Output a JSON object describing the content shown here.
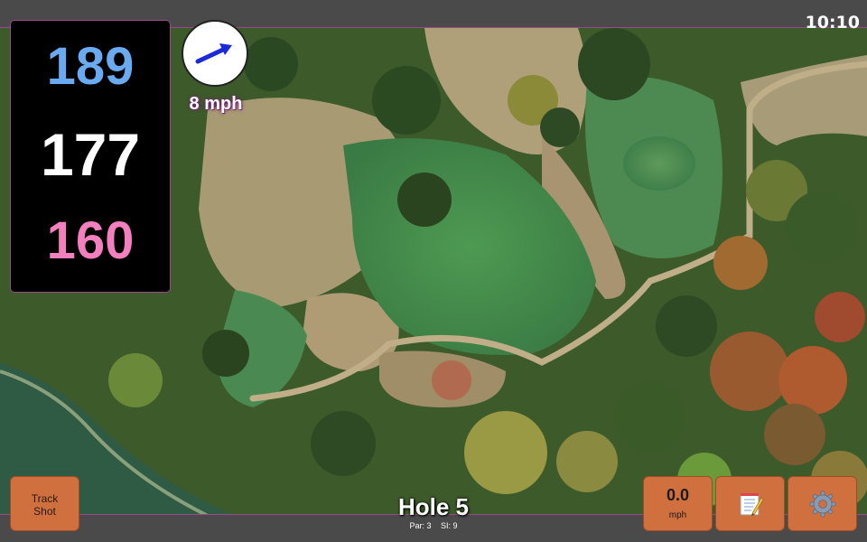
{
  "status_bar": {
    "time": "10:10"
  },
  "distances": {
    "back": "189",
    "middle": "177",
    "front": "160",
    "colors": {
      "back": "#6aaaf0",
      "middle": "#ffffff",
      "front": "#f47fbf"
    }
  },
  "wind": {
    "speed_label": "8 mph",
    "direction_icon": "wind-arrow-icon"
  },
  "buttons": {
    "track_shot_line1": "Track",
    "track_shot_line2": "Shot",
    "wind_value": "0.0",
    "wind_unit": "mph",
    "notes_icon": "notepad-icon",
    "settings_icon": "gear-icon",
    "accent_color": "#d0703f"
  },
  "hole": {
    "title": "Hole 5",
    "par": "Par: 3",
    "si": "SI: 9"
  }
}
